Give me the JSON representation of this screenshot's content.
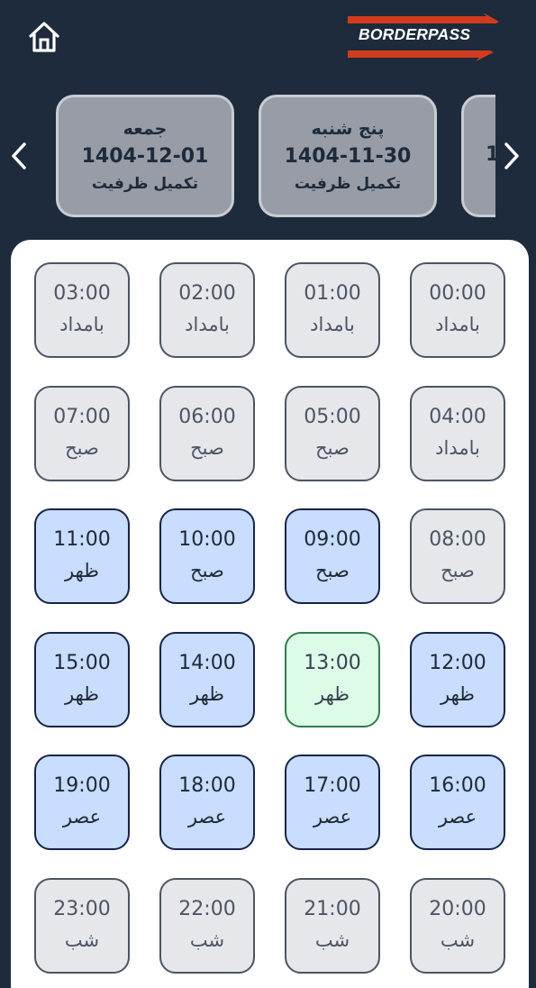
{
  "header": {
    "home_icon": "home-icon",
    "logo_text": "BORDERPASS"
  },
  "colors": {
    "background": "#1e2b3c",
    "day_card": "#979ca7",
    "slot_full": "#e5e7eb",
    "slot_available": "#c8ddff",
    "slot_selected": "#dcfce7",
    "logo_accent": "#d23c1e"
  },
  "days": [
    {
      "name": "جمعه",
      "date": "1404-12-01",
      "status": "تکمیل ظرفیت"
    },
    {
      "name": "پنج شنبه",
      "date": "1404-11-30",
      "status": "تکمیل ظرفیت"
    },
    {
      "name": "",
      "date": "1",
      "status": ""
    }
  ],
  "slots": [
    {
      "time": "03:00",
      "period": "بامداد",
      "state": "full"
    },
    {
      "time": "02:00",
      "period": "بامداد",
      "state": "full"
    },
    {
      "time": "01:00",
      "period": "بامداد",
      "state": "full"
    },
    {
      "time": "00:00",
      "period": "بامداد",
      "state": "full"
    },
    {
      "time": "07:00",
      "period": "صبح",
      "state": "full"
    },
    {
      "time": "06:00",
      "period": "صبح",
      "state": "full"
    },
    {
      "time": "05:00",
      "period": "صبح",
      "state": "full"
    },
    {
      "time": "04:00",
      "period": "بامداد",
      "state": "full"
    },
    {
      "time": "11:00",
      "period": "ظهر",
      "state": "available"
    },
    {
      "time": "10:00",
      "period": "صبح",
      "state": "available"
    },
    {
      "time": "09:00",
      "period": "صبح",
      "state": "available"
    },
    {
      "time": "08:00",
      "period": "صبح",
      "state": "full"
    },
    {
      "time": "15:00",
      "period": "ظهر",
      "state": "available"
    },
    {
      "time": "14:00",
      "period": "ظهر",
      "state": "available"
    },
    {
      "time": "13:00",
      "period": "ظهر",
      "state": "selected"
    },
    {
      "time": "12:00",
      "period": "ظهر",
      "state": "available"
    },
    {
      "time": "19:00",
      "period": "عصر",
      "state": "available"
    },
    {
      "time": "18:00",
      "period": "عصر",
      "state": "available"
    },
    {
      "time": "17:00",
      "period": "عصر",
      "state": "available"
    },
    {
      "time": "16:00",
      "period": "عصر",
      "state": "available"
    },
    {
      "time": "23:00",
      "period": "شب",
      "state": "full"
    },
    {
      "time": "22:00",
      "period": "شب",
      "state": "full"
    },
    {
      "time": "21:00",
      "period": "شب",
      "state": "full"
    },
    {
      "time": "20:00",
      "period": "شب",
      "state": "full"
    }
  ]
}
